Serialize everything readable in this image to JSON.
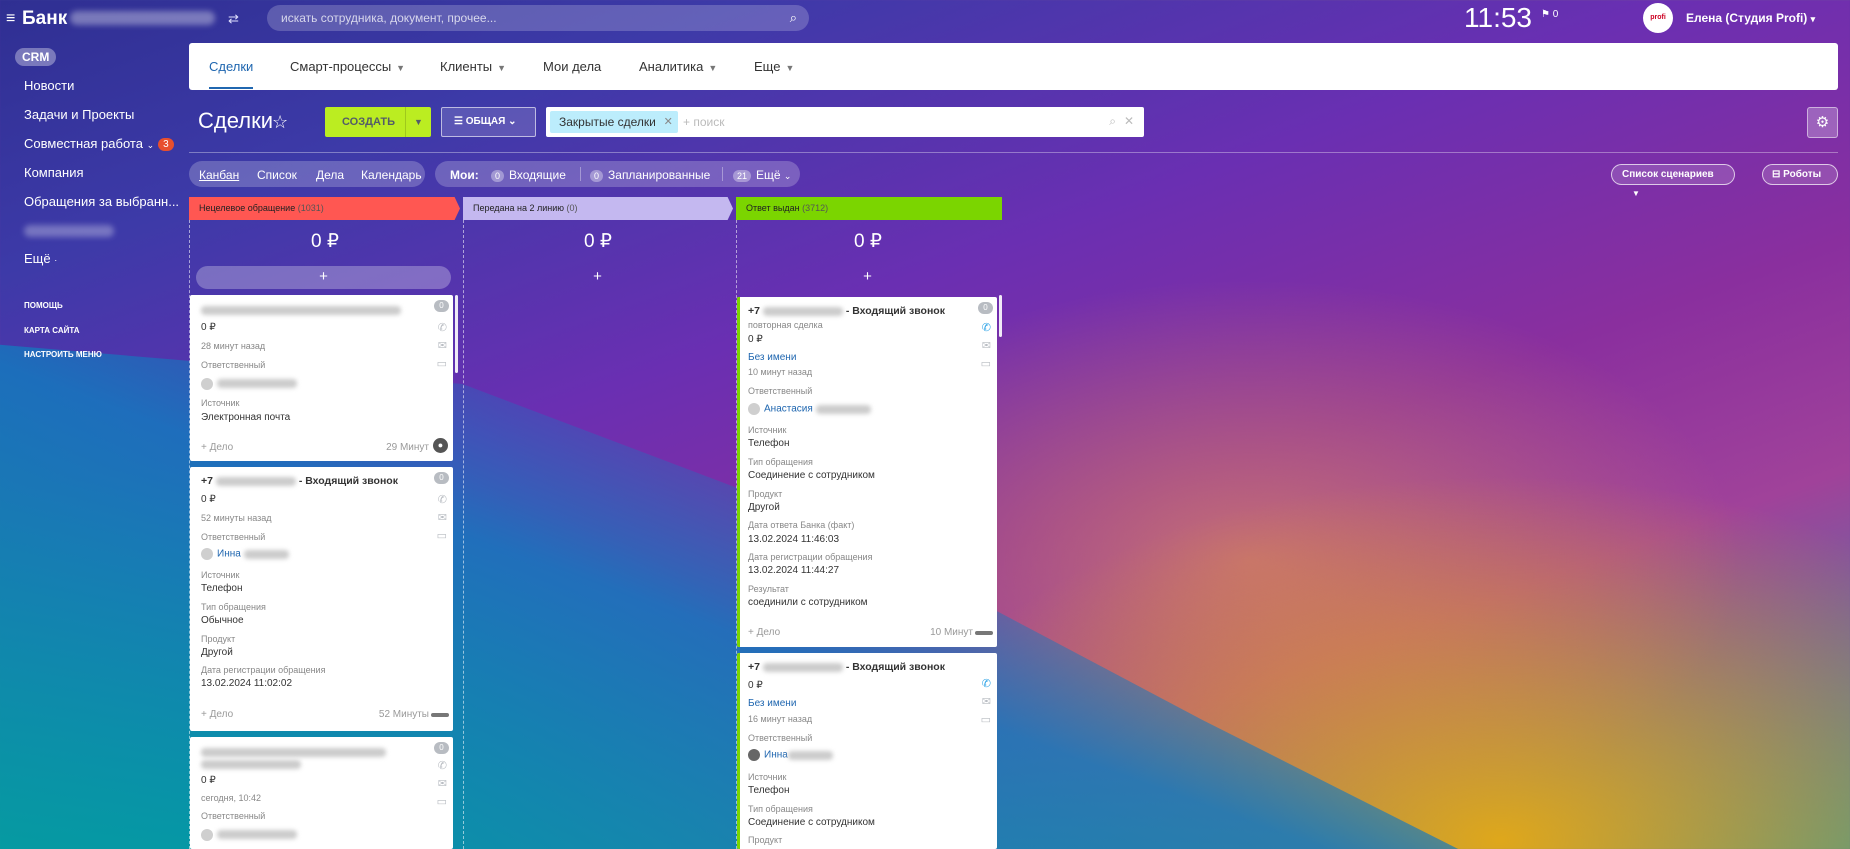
{
  "topbar": {
    "logo": "Банк",
    "search_placeholder": "искать сотрудника, документ, прочее...",
    "clock": "11:53",
    "flag_count": "0",
    "avatar_text": "profi",
    "user_name": "Елена (Студия Profi)"
  },
  "leftmenu": {
    "crm": "CRM",
    "items": [
      "Новости",
      "Задачи и Проекты",
      "Совместная работа",
      "Компания",
      "Обращения за выбранн...",
      "Ещё"
    ],
    "collab_counter": "3",
    "small": [
      "ПОМОЩЬ",
      "КАРТА САЙТА",
      "НАСТРОИТЬ МЕНЮ"
    ]
  },
  "nav": {
    "tabs": [
      "Сделки",
      "Смарт-процессы",
      "Клиенты",
      "Мои дела",
      "Аналитика",
      "Еще"
    ]
  },
  "toolbar": {
    "title": "Сделки",
    "create": "СОЗДАТЬ",
    "filter": "ОБЩАЯ",
    "tag": "Закрытые сделки",
    "search_placeholder": "+ поиск"
  },
  "views": {
    "items": [
      "Канбан",
      "Список",
      "Дела",
      "Календарь"
    ],
    "mine_label": "Мои:",
    "incoming_count": "0",
    "incoming": "Входящие",
    "planned_count": "0",
    "planned": "Запланированные",
    "more_count": "21",
    "more": "Ещё",
    "scenarios": "Список сценариев",
    "robots": "Роботы"
  },
  "columns": [
    {
      "name": "Нецелевое обращение",
      "count": "(1031)",
      "sum": "0 ₽",
      "color": "#ff5752"
    },
    {
      "name": "Передана на 2 линию",
      "count": "(0)",
      "sum": "0 ₽",
      "color": "#c4b8f0"
    },
    {
      "name": "Ответ выдан",
      "count": "(3712)",
      "sum": "0 ₽",
      "color": "#7bd500"
    }
  ],
  "cards": {
    "c1": {
      "amount": "0 ₽",
      "time": "28 минут назад",
      "resp_label": "Ответственный",
      "src_label": "Источник",
      "src": "Электронная почта",
      "add": "+ Дело",
      "ago": "29 Минут",
      "count": "0"
    },
    "c2": {
      "title_prefix": "+7",
      "title_suffix": "- Входящий звонок",
      "amount": "0 ₽",
      "time": "52 минуты назад",
      "resp_label": "Ответственный",
      "resp": "Инна",
      "src_label": "Источник",
      "src": "Телефон",
      "type_label": "Тип обращения",
      "type": "Обычное",
      "prod_label": "Продукт",
      "prod": "Другой",
      "reg_label": "Дата регистрации обращения",
      "reg": "13.02.2024 11:02:02",
      "add": "+ Дело",
      "ago": "52 Минуты",
      "count": "0"
    },
    "c3": {
      "amount": "0 ₽",
      "time": "сегодня, 10:42",
      "resp_label": "Ответственный",
      "count": "0"
    },
    "c4": {
      "title_prefix": "+7",
      "title_suffix": "- Входящий звонок",
      "sub": "повторная сделка",
      "amount": "0 ₽",
      "client": "Без имени",
      "time": "10 минут назад",
      "resp_label": "Ответственный",
      "resp": "Анастасия",
      "src_label": "Источник",
      "src": "Телефон",
      "type_label": "Тип обращения",
      "type": "Соединение с сотрудником",
      "prod_label": "Продукт",
      "prod": "Другой",
      "ans_label": "Дата ответа Банка (факт)",
      "ans": "13.02.2024 11:46:03",
      "reg_label": "Дата регистрации обращения",
      "reg": "13.02.2024 11:44:27",
      "res_label": "Результат",
      "res": "соединили с сотрудником",
      "add": "+ Дело",
      "ago": "10 Минут",
      "count": "0"
    },
    "c5": {
      "title_prefix": "+7",
      "title_suffix": "- Входящий звонок",
      "amount": "0 ₽",
      "client": "Без имени",
      "time": "16 минут назад",
      "resp_label": "Ответственный",
      "resp": "Инна",
      "src_label": "Источник",
      "src": "Телефон",
      "type_label": "Тип обращения",
      "type": "Соединение с сотрудником",
      "prod_label": "Продукт"
    }
  }
}
